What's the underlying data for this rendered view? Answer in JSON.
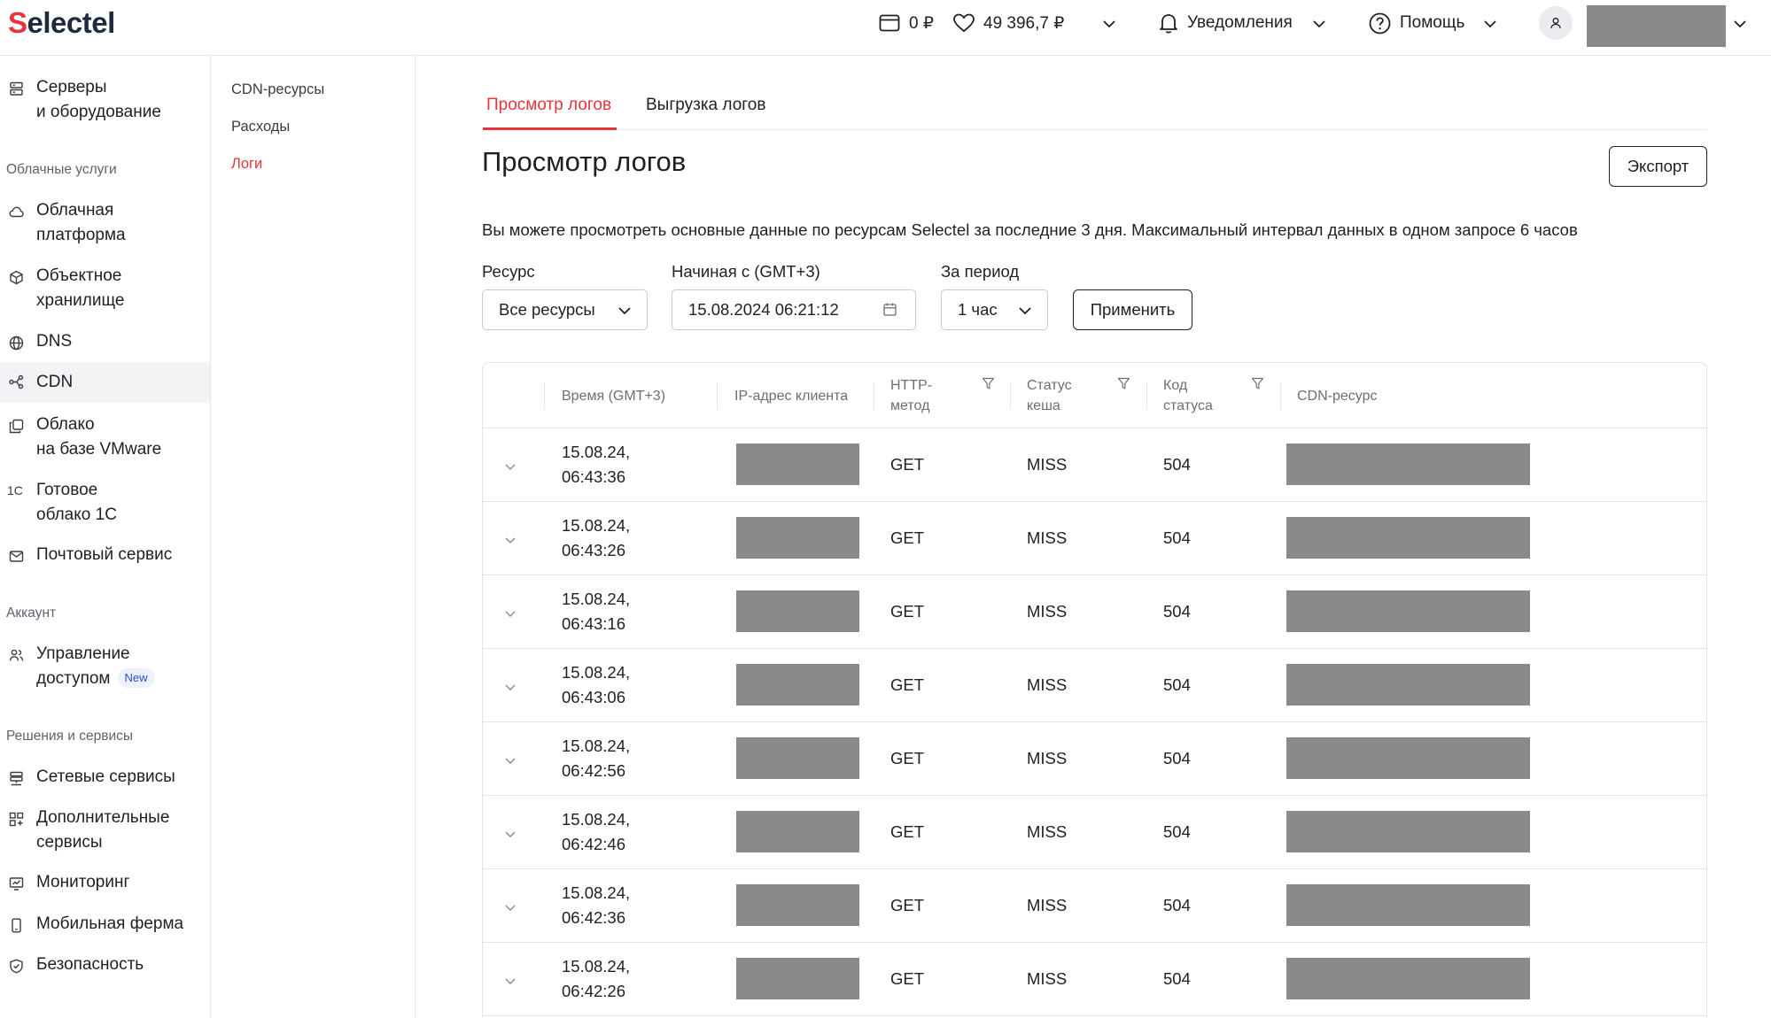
{
  "header": {
    "logo": "Selectel",
    "balance_main": "0 ₽",
    "balance_bonus": "49 396,7 ₽",
    "notifications_label": "Уведомления",
    "help_label": "Помощь"
  },
  "sidebar": {
    "items": [
      {
        "label": "Серверы\nи оборудование",
        "icon": "server-icon"
      },
      {
        "section": "Облачные услуги"
      },
      {
        "label": "Облачная\nплатформа",
        "icon": "cloud-icon"
      },
      {
        "label": "Объектное\nхранилище",
        "icon": "cube-icon"
      },
      {
        "label": "DNS",
        "icon": "globe-icon"
      },
      {
        "label": "CDN",
        "icon": "cdn-icon",
        "active": true
      },
      {
        "label": "Облако\nна базе VMware",
        "icon": "vmware-icon"
      },
      {
        "label": "Готовое\nоблако 1С",
        "icon": "1c-icon"
      },
      {
        "label": "Почтовый сервис",
        "icon": "mail-icon"
      },
      {
        "section": "Аккаунт"
      },
      {
        "label": "Управление\nдоступом",
        "icon": "users-icon",
        "badge": "New"
      },
      {
        "section": "Решения и сервисы"
      },
      {
        "label": "Сетевые сервисы",
        "icon": "network-icon"
      },
      {
        "label": "Дополнительные\nсервисы",
        "icon": "grid-plus-icon"
      },
      {
        "label": "Мониторинг",
        "icon": "monitor-icon"
      },
      {
        "label": "Мобильная ферма",
        "icon": "phone-icon"
      },
      {
        "label": "Безопасность",
        "icon": "shield-icon"
      }
    ],
    "sections": {
      "cloud": "Облачные услуги",
      "account": "Аккаунт",
      "solutions": "Решения и сервисы"
    },
    "labels": {
      "servers": "Серверы\nи оборудование",
      "cloud_platform": "Облачная\nплатформа",
      "object_storage": "Объектное\nхранилище",
      "dns": "DNS",
      "cdn": "CDN",
      "vmware": "Облако\nна базе VMware",
      "cloud_1c": "Готовое\nоблако 1С",
      "mail": "Почтовый сервис",
      "access": "Управление\nдоступом",
      "access_badge": "New",
      "network": "Сетевые сервисы",
      "additional": "Дополнительные\nсервисы",
      "monitoring": "Мониторинг",
      "mobile_farm": "Мобильная ферма",
      "security": "Безопасность"
    },
    "icon_1c": "1С"
  },
  "subnav": {
    "cdn_resources": "CDN-ресурсы",
    "expenses": "Расходы",
    "logs": "Логи"
  },
  "tabs": {
    "view_logs": "Просмотр логов",
    "export_logs": "Выгрузка логов"
  },
  "page": {
    "title": "Просмотр логов",
    "export_button": "Экспорт",
    "description": "Вы можете просмотреть основные данные по ресурсам Selectel за последние 3 дня. Максимальный интервал данных в одном запросе 6 часов"
  },
  "filters": {
    "resource_label": "Ресурс",
    "resource_value": "Все ресурсы",
    "start_label": "Начиная с (GMT+3)",
    "start_value": "15.08.2024 06:21:12",
    "period_label": "За период",
    "period_value": "1 час",
    "apply_button": "Применить"
  },
  "table": {
    "columns": {
      "time": "Время (GMT+3)",
      "ip": "IP-адрес клиента",
      "method": "HTTP-\nметод",
      "cache": "Статус\nкеша",
      "code": "Код\nстатуса",
      "resource": "CDN-ресурс"
    },
    "rows": [
      {
        "time": "15.08.24,\n06:43:36",
        "method": "GET",
        "cache": "MISS",
        "code": "504"
      },
      {
        "time": "15.08.24,\n06:43:26",
        "method": "GET",
        "cache": "MISS",
        "code": "504"
      },
      {
        "time": "15.08.24,\n06:43:16",
        "method": "GET",
        "cache": "MISS",
        "code": "504"
      },
      {
        "time": "15.08.24,\n06:43:06",
        "method": "GET",
        "cache": "MISS",
        "code": "504"
      },
      {
        "time": "15.08.24,\n06:42:56",
        "method": "GET",
        "cache": "MISS",
        "code": "504"
      },
      {
        "time": "15.08.24,\n06:42:46",
        "method": "GET",
        "cache": "MISS",
        "code": "504"
      },
      {
        "time": "15.08.24,\n06:42:36",
        "method": "GET",
        "cache": "MISS",
        "code": "504"
      },
      {
        "time": "15.08.24,\n06:42:26",
        "method": "GET",
        "cache": "MISS",
        "code": "504"
      }
    ]
  },
  "colors": {
    "brand_red": "#e8343c",
    "redacted_gray": "#8a8a8a"
  }
}
